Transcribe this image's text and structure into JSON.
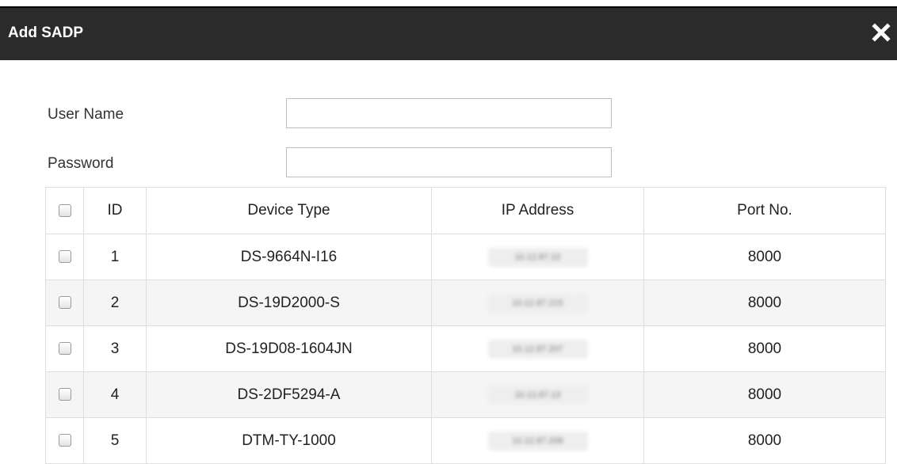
{
  "dialog": {
    "title": "Add SADP",
    "close_icon": "close-icon"
  },
  "form": {
    "username_label": "User Name",
    "username_value": "",
    "password_label": "Password",
    "password_value": ""
  },
  "table": {
    "headers": {
      "id": "ID",
      "device_type": "Device Type",
      "ip_address": "IP Address",
      "port": "Port No."
    },
    "rows": [
      {
        "id": "1",
        "device_type": "DS-9664N-I16",
        "ip_address": "10.12.87.22",
        "port": "8000"
      },
      {
        "id": "2",
        "device_type": "DS-19D2000-S",
        "ip_address": "10.12.87.215",
        "port": "8000"
      },
      {
        "id": "3",
        "device_type": "DS-19D08-1604JN",
        "ip_address": "10.12.87.207",
        "port": "8000"
      },
      {
        "id": "4",
        "device_type": "DS-2DF5294-A",
        "ip_address": "10.12.87.13",
        "port": "8000"
      },
      {
        "id": "5",
        "device_type": "DTM-TY-1000",
        "ip_address": "10.12.87.208",
        "port": "8000"
      }
    ]
  },
  "colors": {
    "titlebar": "#2b2b2b",
    "title_text": "#ffffff",
    "row_alt": "#f5f5f5",
    "grid_border": "#dedede"
  }
}
